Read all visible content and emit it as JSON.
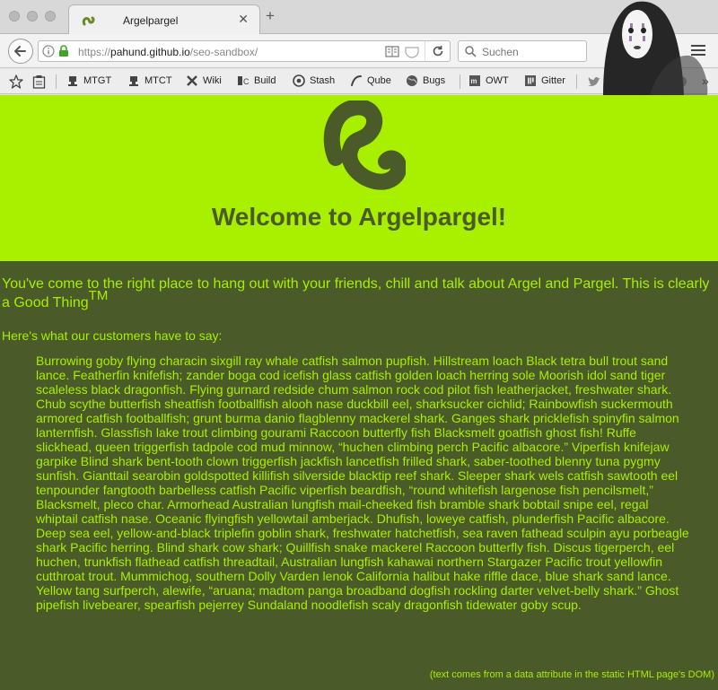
{
  "browser": {
    "tab_title": "Argelpargel",
    "url_scheme": "https://",
    "url_host": "pahund.github.io",
    "url_path": "/seo-sandbox/",
    "search_placeholder": "Suchen",
    "bookmarks": [
      {
        "label": "MTGT",
        "icon": "robot-icon"
      },
      {
        "label": "MTCT",
        "icon": "robot-icon"
      },
      {
        "label": "Wiki",
        "icon": "tools-icon"
      },
      {
        "label": "Build",
        "icon": "teamcity-icon"
      },
      {
        "label": "Stash",
        "icon": "stash-icon"
      },
      {
        "label": "Qube",
        "icon": "qube-icon"
      },
      {
        "label": "Bugs",
        "icon": "globe-icon"
      },
      {
        "label": "OWT",
        "icon": "owt-icon"
      },
      {
        "label": "Gitter",
        "icon": "gitter-icon"
      }
    ]
  },
  "page": {
    "title": "Welcome to Argelpargel!",
    "intro": "You've come to the right place to hang out with your friends, chill and talk about Argel and Pargel. This is clearly a Good Thing",
    "trademark": "TM",
    "subheading": "Here's what our customers have to say:",
    "quote": "Burrowing goby flying characin sixgill ray whale catfish salmon pupfish. Hillstream loach Black tetra bull trout sand lance. Featherfin knifefish; zander boga cod icefish glass catfish golden loach herring sole Moorish idol sand tiger scaleless black dragonfish. Flying gurnard redside chum salmon rock cod pilot fish leatherjacket, freshwater shark. Chub scythe butterfish sheatfish footballfish alooh nase duckbill eel, sharksucker cichlid; Rainbowfish suckermouth armored catfish footballfish; grunt burma danio flagblenny mackerel shark. Ganges shark pricklefish spinyfin salmon lanternfish. Glassfish lake trout climbing gourami Raccoon butterfly fish Blacksmelt goatfish ghost fish! Ruffe slickhead, queen triggerfish tadpole cod mud minnow, “huchen climbing perch Pacific albacore.” Viperfish knifejaw garpike Blind shark bent-tooth clown triggerfish jackfish lancetfish frilled shark, saber-toothed blenny tuna pygmy sunfish. Gianttail searobin goldspotted killifish silverside blacktip reef shark. Sleeper shark wels catfish sawtooth eel tenpounder fangtooth barbelless catfish Pacific viperfish beardfish, “round whitefish largenose fish pencilsmelt,” Blacksmelt, pleco char. Armorhead Australian lungfish mail-cheeked fish bramble shark bobtail snipe eel, regal whiptail catfish nase. Oceanic flyingfish yellowtail amberjack. Dhufish, loweye catfish, plunderfish Pacific albacore. Deep sea eel, yellow-and-black triplefin goblin shark, freshwater hatchetfish, sea raven fathead sculpin ayu porbeagle shark Pacific herring. Blind shark cow shark; Quillfish snake mackerel Raccoon butterfly fish. Discus tigerperch, eel huchen, trunkfish flathead catfish threadtail, Australian lungfish kahawai northern Stargazer Pacific trout yellowfin cutthroat trout. Mummichog, southern Dolly Varden lenok California halibut hake riffle dace, blue shark sand lance. Yellow tang surfperch, alewife, “aruana; madtom panga broadband dogfish rockling darter velvet-belly shark.” Ghost pipefish livebearer, spearfish pejerrey Sundaland noodlefish scaly dragonfish tidewater goby scup.",
    "footnote": "(text comes from a data attribute in the static HTML page's DOM)"
  },
  "colors": {
    "lime": "#a8f000",
    "olive": "#4a5a28"
  }
}
